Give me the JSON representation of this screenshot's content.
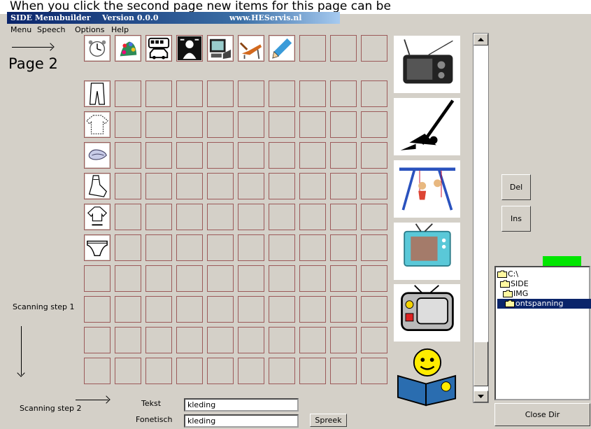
{
  "banner": {
    "text": "When you click the second page new items for this page can be"
  },
  "app": {
    "title": "SIDE  Menubuilder",
    "version": "Version 0.0.0",
    "url": "www.HEServis.nl"
  },
  "menu": {
    "items": [
      "Menu",
      "Speech",
      "Options",
      "Help"
    ]
  },
  "page_label": "Page 2",
  "scan": {
    "step1": "Scanning step 1",
    "step2": "Scanning step 2"
  },
  "top_row_icons": [
    "clock-icon",
    "flowers-icon",
    "bus-car-icon",
    "hairdresser-icon",
    "computer-icon",
    "sunbed-icon",
    "pencil-icon"
  ],
  "left_column_icons": [
    "trousers-icon",
    "sweater-icon",
    "socks-icon",
    "shoe-icon",
    "shirt-icon",
    "underpants-icon"
  ],
  "cards": [
    "radio-icon",
    "golf-player-icon",
    "swing-set-icon",
    "television-icon",
    "tv-drawing-icon",
    "smiley-book-icon"
  ],
  "buttons": {
    "del": "Del",
    "ins": "Ins",
    "close_dir": "Close Dir",
    "speak": "Spreek"
  },
  "dirs": [
    {
      "name": "C:\\",
      "selected": false
    },
    {
      "name": "SIDE",
      "selected": false
    },
    {
      "name": "IMG",
      "selected": false
    },
    {
      "name": "ontspanning",
      "selected": true
    }
  ],
  "form": {
    "tekst_label": "Tekst",
    "tekst_value": "kleding",
    "fonetisch_label": "Fonetisch",
    "fonetisch_value": "kleding"
  },
  "colors": {
    "titlebar": "#0a246a",
    "selection": "#0a246a",
    "indicator": "#00e600",
    "cell_border": "#9c5a5a"
  }
}
